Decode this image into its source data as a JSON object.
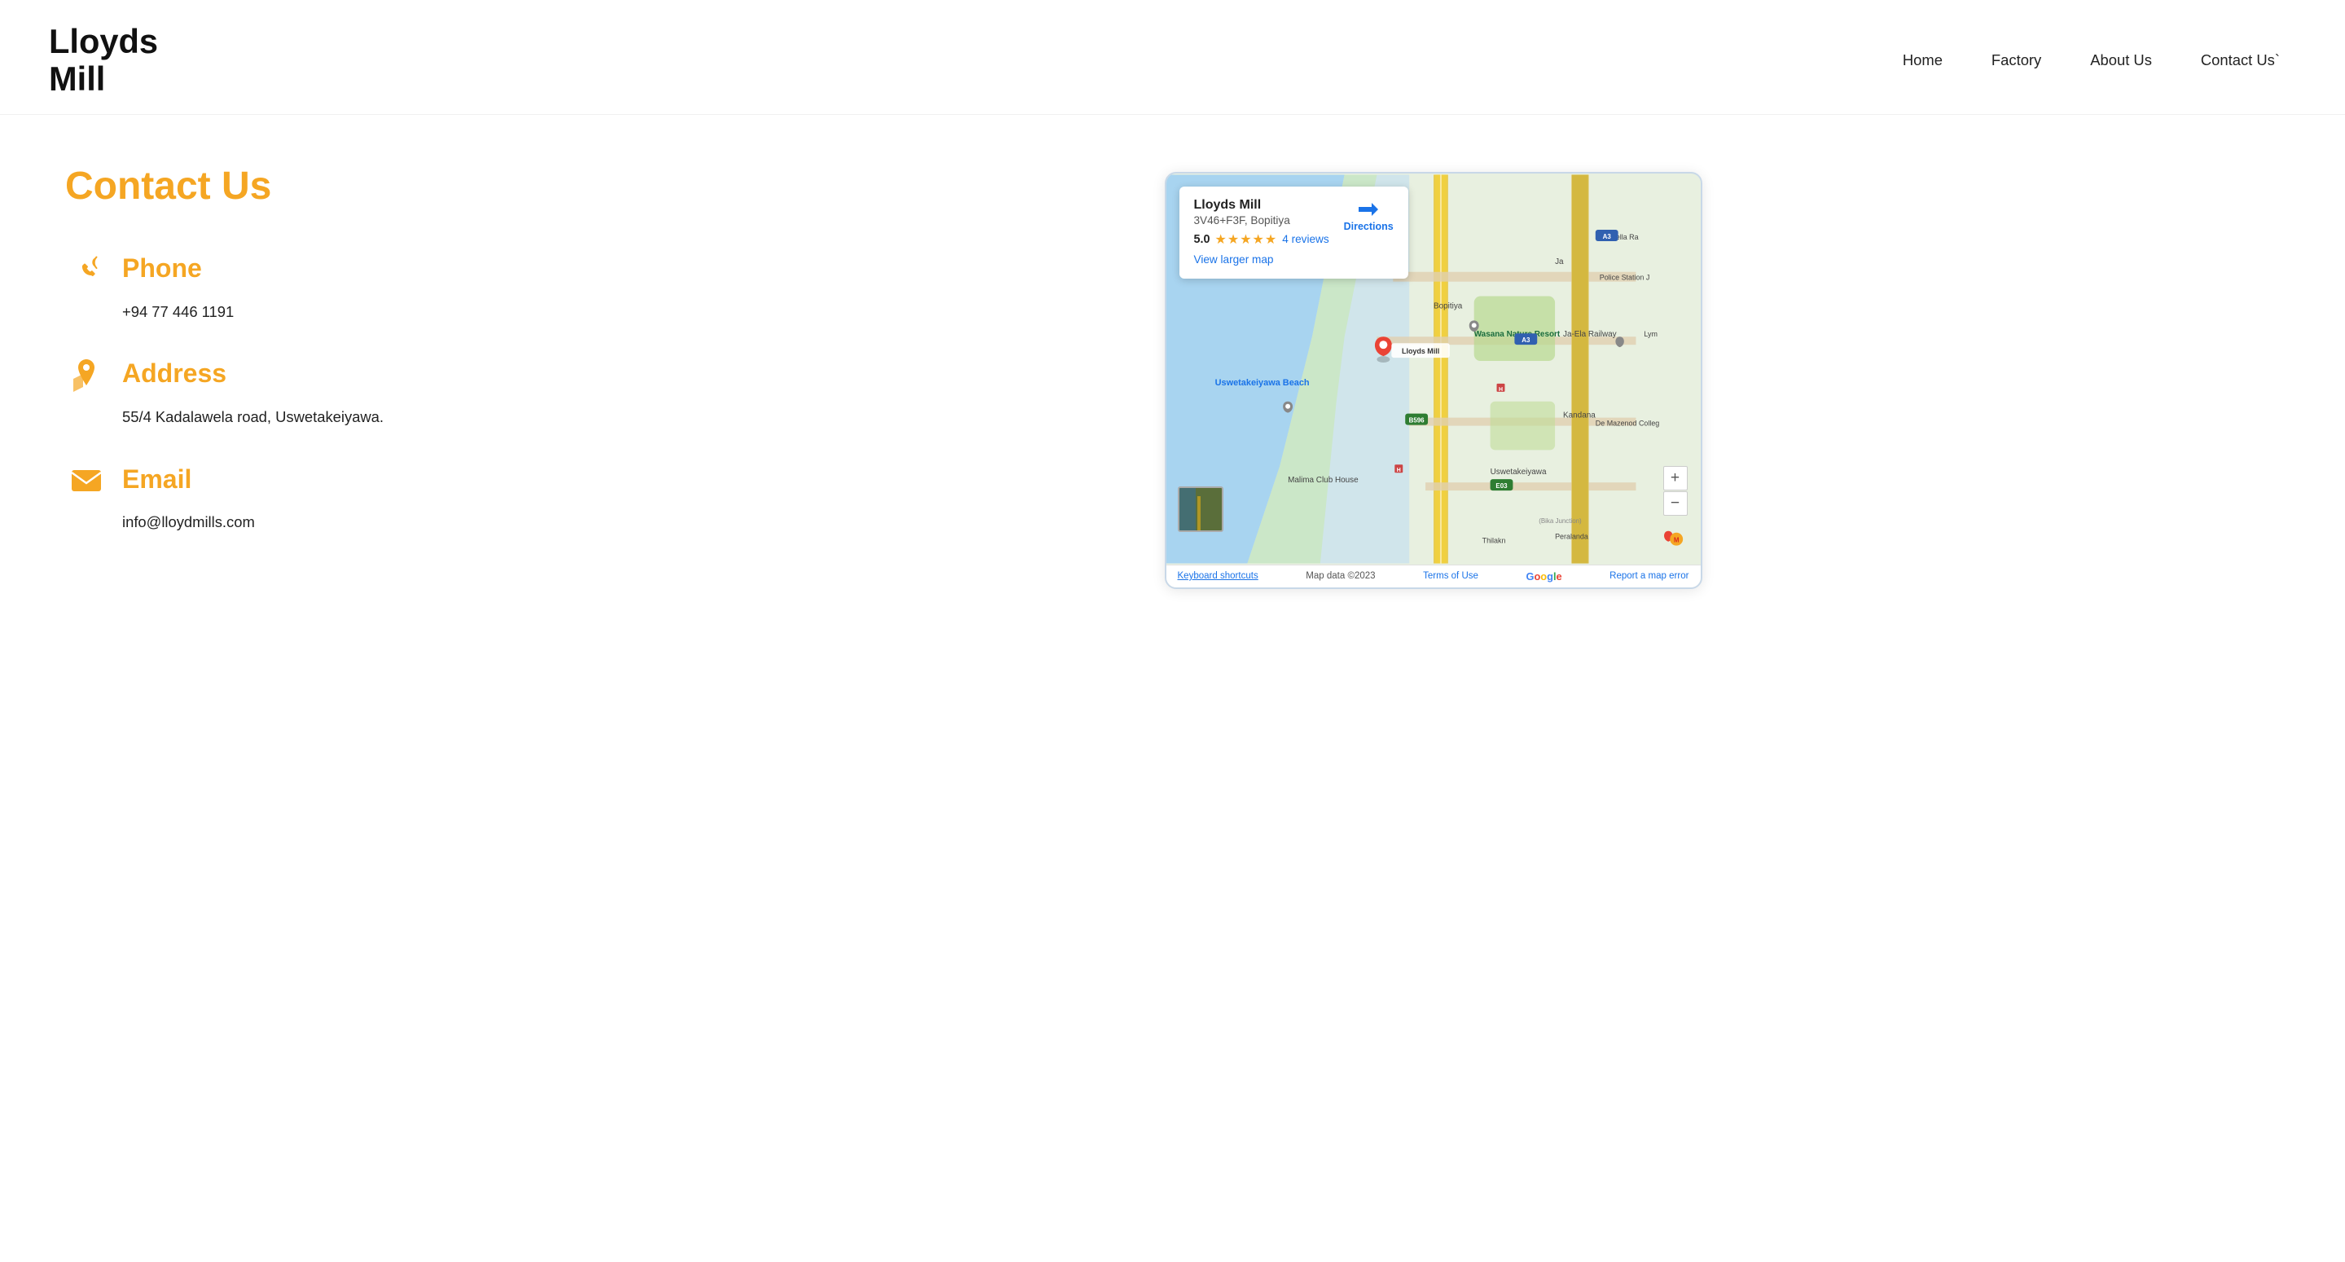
{
  "site": {
    "logo_line1": "Lloyds",
    "logo_line2": "Mill"
  },
  "nav": {
    "home": "Home",
    "factory": "Factory",
    "about": "About Us",
    "contact": "Contact Us`"
  },
  "page": {
    "title": "Contact Us"
  },
  "contact": {
    "phone_label": "Phone",
    "phone_value": "+94 77 446 1191",
    "address_label": "Address",
    "address_value": "55/4 Kadalawela road, Uswetakeiyawa.",
    "email_label": "Email",
    "email_value": "info@lloydmills.com"
  },
  "map": {
    "business_name": "Lloyds Mill",
    "address": "3V46+F3F, Bopitiya",
    "rating": "5.0",
    "stars": "★★★★★",
    "reviews_count": "4 reviews",
    "directions_label": "Directions",
    "view_larger": "View larger map",
    "footer_keyboard": "Keyboard shortcuts",
    "footer_data": "Map data ©2023",
    "footer_terms": "Terms of Use",
    "footer_report": "Report a map error",
    "zoom_in": "+",
    "zoom_out": "−"
  }
}
